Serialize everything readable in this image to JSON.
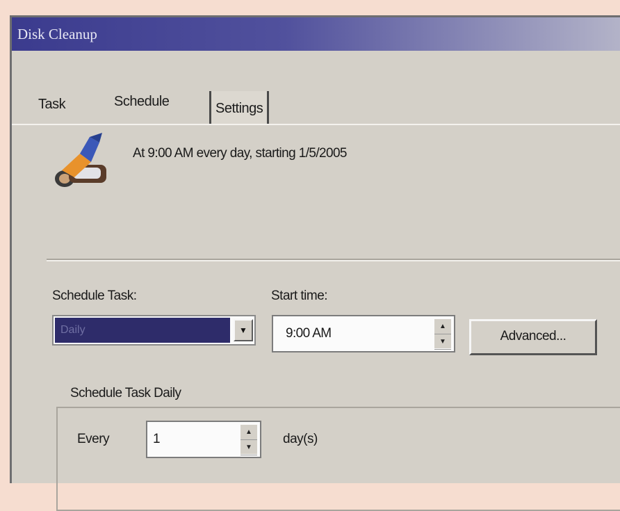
{
  "window": {
    "title": "Disk Cleanup"
  },
  "tabs": [
    {
      "label": "Task"
    },
    {
      "label": "Schedule"
    },
    {
      "label": "Settings"
    }
  ],
  "schedule_tab": {
    "summary": "At 9:00 AM every day, starting 1/5/2005",
    "schedule_task_label": "Schedule Task:",
    "schedule_task_value": "Daily",
    "start_time_label": "Start time:",
    "start_time_value": "9:00 AM",
    "advanced_button": "Advanced...",
    "group_title": "Schedule Task Daily",
    "every_label": "Every",
    "every_value": "1",
    "days_label": "day(s)"
  },
  "colors": {
    "titlebar_start": "#3b3b8e",
    "dialog_face": "#d4d0c8",
    "selection": "#2e2c6a"
  },
  "icons": {
    "task": "scheduled-task-icon"
  }
}
